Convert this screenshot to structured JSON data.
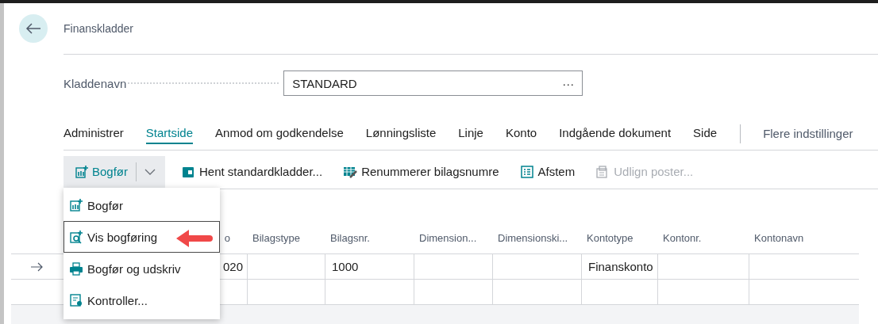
{
  "page": {
    "title": "Finanskladder"
  },
  "field": {
    "label": "Kladdenavn",
    "value": "STANDARD",
    "lookup_text": "···"
  },
  "tabs": [
    {
      "label": "Administrer",
      "selected": false
    },
    {
      "label": "Startside",
      "selected": true
    },
    {
      "label": "Anmod om godkendelse",
      "selected": false
    },
    {
      "label": "Lønningsliste",
      "selected": false
    },
    {
      "label": "Linje",
      "selected": false
    },
    {
      "label": "Konto",
      "selected": false
    },
    {
      "label": "Indgående dokument",
      "selected": false
    },
    {
      "label": "Side",
      "selected": false
    }
  ],
  "more_tab": "Flere indstillinger",
  "actions": [
    {
      "label": "Bogfør",
      "kind": "split",
      "disabled": false
    },
    {
      "label": "Hent standardkladder...",
      "kind": "button",
      "disabled": false
    },
    {
      "label": "Renummerer bilagsnumre",
      "kind": "button",
      "disabled": false
    },
    {
      "label": "Afstem",
      "kind": "button",
      "disabled": false
    },
    {
      "label": "Udlign poster...",
      "kind": "button",
      "disabled": true
    }
  ],
  "menu": {
    "items": [
      {
        "label": "Bogfør",
        "selected": false
      },
      {
        "label": "Vis bogføring",
        "selected": true
      },
      {
        "label": "Bogfør og udskriv",
        "selected": false
      },
      {
        "label": "Kontroller...",
        "selected": false
      }
    ]
  },
  "table": {
    "columns": [
      "o",
      "Bilagstype",
      "Bilagsnr.",
      "Dimension...",
      "Dimensionski...",
      "Kontotype",
      "Kontonr.",
      "Kontonavn"
    ],
    "rows": [
      {
        "current": true,
        "cells": [
          "020",
          null,
          "1000",
          null,
          null,
          "Finanskonto",
          null,
          null
        ]
      },
      {
        "current": false,
        "cells": [
          null,
          null,
          null,
          null,
          null,
          null,
          null,
          null
        ]
      }
    ]
  }
}
